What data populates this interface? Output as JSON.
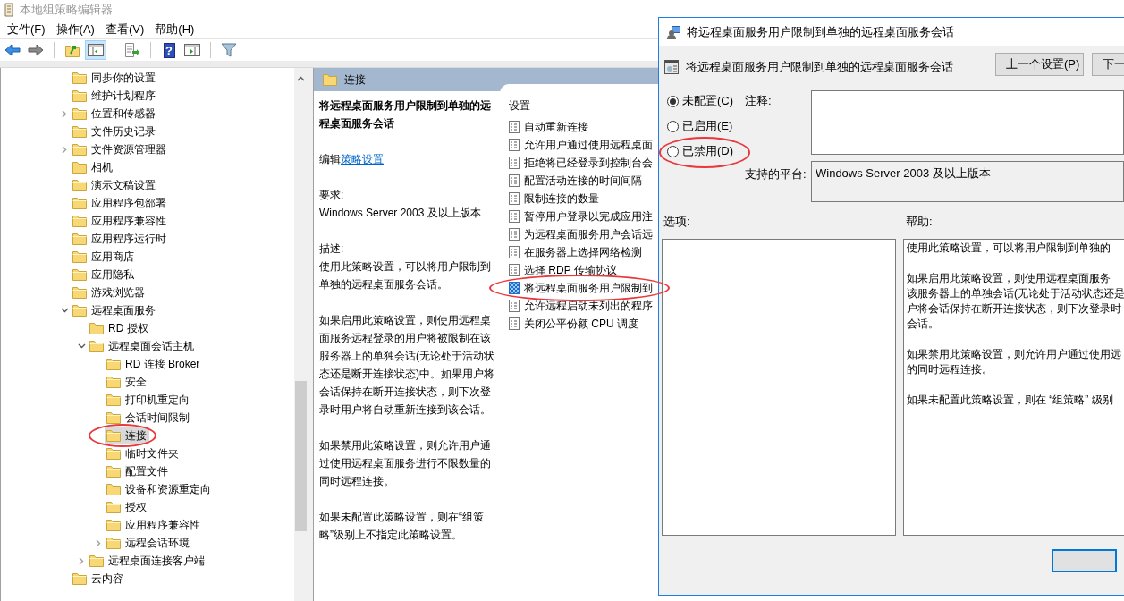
{
  "window": {
    "title": "本地组策略编辑器"
  },
  "menu": [
    "文件(F)",
    "操作(A)",
    "查看(V)",
    "帮助(H)"
  ],
  "toolbar": [
    [
      {
        "kind": "back",
        "pressed": false
      },
      {
        "kind": "forward",
        "pressed": false
      }
    ],
    [
      {
        "kind": "up",
        "pressed": false
      },
      {
        "kind": "tree",
        "pressed": true
      }
    ],
    [
      {
        "kind": "export",
        "pressed": false
      }
    ],
    [
      {
        "kind": "help",
        "pressed": false,
        "glyph": "?"
      },
      {
        "kind": "pane",
        "pressed": false
      }
    ],
    [
      {
        "kind": "filter",
        "pressed": false
      }
    ]
  ],
  "tree": [
    {
      "label": "同步你的设置",
      "selected": false
    },
    {
      "label": "维护计划程序",
      "selected": false
    },
    {
      "label": "位置和传感器",
      "selected": false,
      "expanded": false
    },
    {
      "label": "文件历史记录",
      "selected": false
    },
    {
      "label": "文件资源管理器",
      "selected": false,
      "expanded": false
    },
    {
      "label": "相机",
      "selected": false
    },
    {
      "label": "演示文稿设置",
      "selected": false
    },
    {
      "label": "应用程序包部署",
      "selected": false
    },
    {
      "label": "应用程序兼容性",
      "selected": false
    },
    {
      "label": "应用程序运行时",
      "selected": false
    },
    {
      "label": "应用商店",
      "selected": false
    },
    {
      "label": "应用隐私",
      "selected": false
    },
    {
      "label": "游戏浏览器",
      "selected": false
    },
    {
      "label": "远程桌面服务",
      "selected": false,
      "expanded": true,
      "children": [
        {
          "label": "RD 授权",
          "selected": false
        },
        {
          "label": "远程桌面会话主机",
          "selected": false,
          "expanded": true,
          "children": [
            {
              "label": "RD 连接 Broker",
              "selected": false
            },
            {
              "label": "安全",
              "selected": false
            },
            {
              "label": "打印机重定向",
              "selected": false
            },
            {
              "label": "会话时间限制",
              "selected": false
            },
            {
              "label": "连接",
              "selected": true,
              "circled": true
            },
            {
              "label": "临时文件夹",
              "selected": false
            },
            {
              "label": "配置文件",
              "selected": false
            },
            {
              "label": "设备和资源重定向",
              "selected": false
            },
            {
              "label": "授权",
              "selected": false
            },
            {
              "label": "应用程序兼容性",
              "selected": false
            },
            {
              "label": "远程会话环境",
              "selected": false,
              "expanded": false
            }
          ]
        },
        {
          "label": "远程桌面连接客户端",
          "selected": false,
          "expanded": false
        }
      ]
    },
    {
      "label": "云内容",
      "selected": false
    }
  ],
  "pane_header": "连接",
  "description": {
    "title": "将远程桌面服务用户限制到单独的远程桌面服务会话",
    "edit_prefix": "编辑",
    "edit_link": "策略设置",
    "requirements_label": "要求:",
    "requirements": "Windows Server 2003 及以上版本",
    "description_label": "描述:",
    "paragraphs": [
      "使用此策略设置，可以将用户限制到单独的远程桌面服务会话。",
      "如果启用此策略设置，则使用远程桌面服务远程登录的用户将被限制在该服务器上的单独会话(无论处于活动状态还是断开连接状态)中。如果用户将会话保持在断开连接状态，则下次登录时用户将自动重新连接到该会话。",
      "如果禁用此策略设置，则允许用户通过使用远程桌面服务进行不限数量的同时远程连接。",
      "如果未配置此策略设置，则在“组策略”级别上不指定此策略设置。"
    ]
  },
  "settings": {
    "header": "设置",
    "items": [
      {
        "label": "自动重新连接",
        "selected": false
      },
      {
        "label": "允许用户通过使用远程桌面",
        "selected": false
      },
      {
        "label": "拒绝将已经登录到控制台会",
        "selected": false
      },
      {
        "label": "配置活动连接的时间间隔",
        "selected": false
      },
      {
        "label": "限制连接的数量",
        "selected": false
      },
      {
        "label": "暂停用户登录以完成应用注",
        "selected": false
      },
      {
        "label": "为远程桌面服务用户会话远",
        "selected": false
      },
      {
        "label": "在服务器上选择网络检测",
        "selected": false
      },
      {
        "label": "选择 RDP 传输协议",
        "selected": false
      },
      {
        "label": "将远程桌面服务用户限制到",
        "selected": true,
        "circled": true
      },
      {
        "label": "允许远程启动未列出的程序",
        "selected": false
      },
      {
        "label": "关闭公平份额 CPU 调度",
        "selected": false
      }
    ]
  },
  "dialog": {
    "title": "将远程桌面服务用户限制到单独的远程桌面服务会话",
    "heading": "将远程桌面服务用户限制到单独的远程桌面服务会话",
    "buttons": [
      "上一个设置(P)",
      "下一"
    ],
    "radios": [
      {
        "label": "未配置(C)",
        "selected": true
      },
      {
        "label": "已启用(E)",
        "selected": false
      },
      {
        "label": "已禁用(D)",
        "selected": false,
        "circled": true
      }
    ],
    "comment_label": "注释:",
    "platform_label": "支持的平台:",
    "platform": "Windows Server 2003 及以上版本",
    "options_label": "选项:",
    "help_label": "帮助:",
    "help": [
      [
        "使用此策略设置，可以将用户限制到单独的"
      ],
      [
        "如果启用此策略设置，则使用远程桌面服务",
        "该服务器上的单独会话(无论处于活动状态还是",
        "户将会话保持在断开连接状态，则下次登录时",
        "会话。"
      ],
      [
        "如果禁用此策略设置，则允许用户通过使用远",
        "的同时远程连接。"
      ],
      [
        "如果未配置此策略设置，则在 “组策略” 级别"
      ]
    ]
  }
}
